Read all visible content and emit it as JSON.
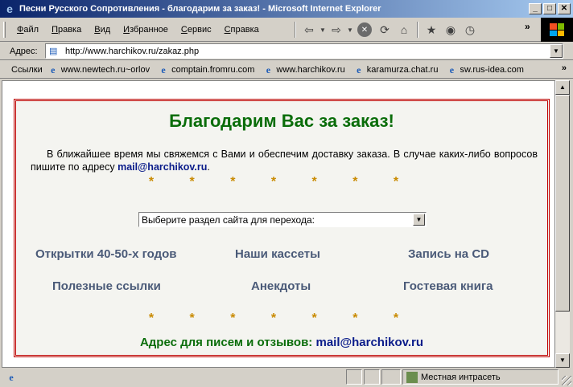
{
  "window": {
    "title": "Песни Русского Сопротивления - благодарим за заказ! - Microsoft Internet Explorer",
    "minimize": "_",
    "maximize": "□",
    "close": "✕"
  },
  "menu": {
    "items": [
      "Файл",
      "Правка",
      "Вид",
      "Избранное",
      "Сервис",
      "Справка"
    ]
  },
  "address": {
    "label": "Адрес:",
    "url": "http://www.harchikov.ru/zakaz.php"
  },
  "links": {
    "label": "Ссылки",
    "items": [
      {
        "label": "www.newtech.ru~orlov"
      },
      {
        "label": "comptain.fromru.com"
      },
      {
        "label": "www.harchikov.ru"
      },
      {
        "label": "karamurza.chat.ru"
      },
      {
        "label": "sw.rus-idea.com"
      }
    ]
  },
  "page": {
    "headline": "Благодарим Вас за заказ!",
    "notice": "В ближайшее время мы свяжемся с Вами и обеспечим доставку заказа. В случае каких-либо вопросов пишите по адресу",
    "notice_email": "mail@harchikov.ru",
    "notice_end": ".",
    "stars": "* * * * * * *",
    "select_value": "Выберите раздел сайта для перехода:",
    "nav_links": [
      "Открытки 40-50-х годов",
      "Наши кассеты",
      "Запись на CD",
      "Полезные ссылки",
      "Анекдоты",
      "Гостевая книга"
    ],
    "footer_label": "Адрес для писем и отзывов:",
    "footer_email": "mail@harchikov.ru"
  },
  "status": {
    "zone": "Местная интрасеть"
  }
}
